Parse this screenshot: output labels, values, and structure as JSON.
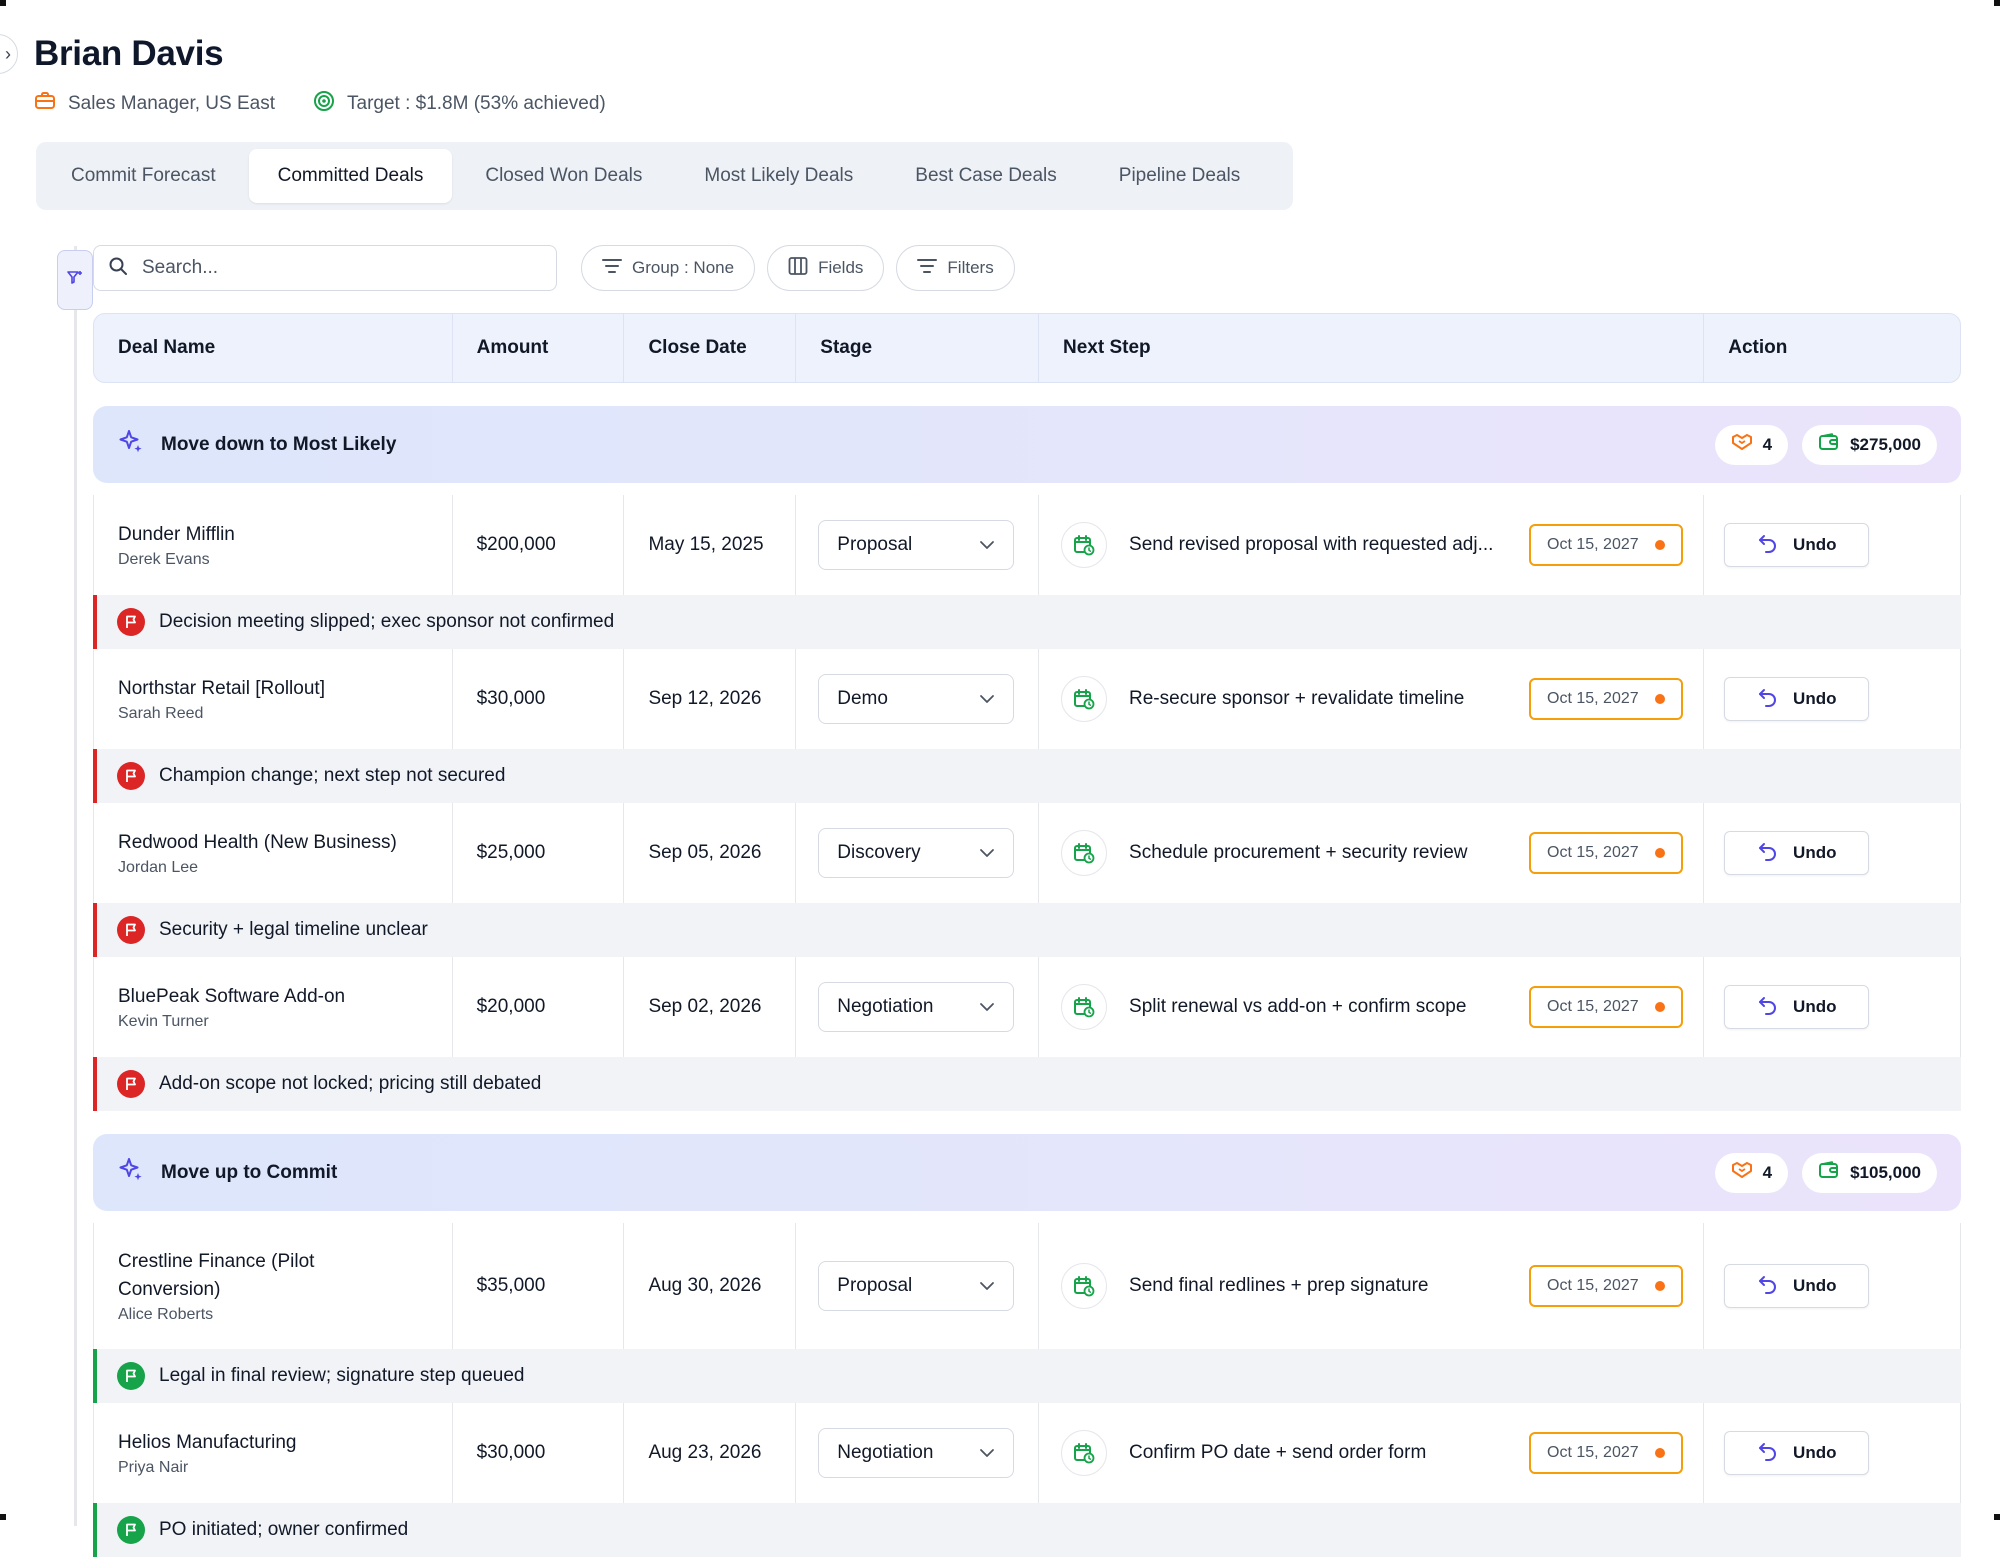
{
  "header": {
    "title": "Brian Davis",
    "role": "Sales Manager, US East",
    "target": "Target : $1.8M (53% achieved)"
  },
  "tabs": [
    {
      "label": "Commit Forecast",
      "active": false
    },
    {
      "label": "Committed Deals",
      "active": true
    },
    {
      "label": "Closed Won Deals",
      "active": false
    },
    {
      "label": "Most Likely Deals",
      "active": false
    },
    {
      "label": "Best Case Deals",
      "active": false
    },
    {
      "label": "Pipeline Deals",
      "active": false
    }
  ],
  "toolbar": {
    "search_placeholder": "Search...",
    "group_label": "Group : None",
    "fields_label": "Fields",
    "filters_label": "Filters"
  },
  "columns": [
    "Deal Name",
    "Amount",
    "Close Date",
    "Stage",
    "Next Step",
    "Action"
  ],
  "groups": [
    {
      "title": "Move down to Most Likely",
      "count": "4",
      "total": "$275,000",
      "deals": [
        {
          "name": "Dunder Mifflin",
          "owner": "Derek Evans",
          "amount": "$200,000",
          "close_date": "May 15, 2025",
          "stage": "Proposal",
          "next_step": "Send revised proposal with requested adj...",
          "step_date": "Oct 15, 2027",
          "action": "Undo",
          "note": "Decision meeting slipped; exec sponsor not confirmed",
          "note_status": "red"
        },
        {
          "name": "Northstar Retail [Rollout]",
          "owner": "Sarah Reed",
          "amount": "$30,000",
          "close_date": "Sep 12, 2026",
          "stage": "Demo",
          "next_step": "Re-secure sponsor + revalidate timeline",
          "step_date": "Oct 15, 2027",
          "action": "Undo",
          "note": "Champion change; next step not secured",
          "note_status": "red"
        },
        {
          "name": "Redwood Health (New Business)",
          "owner": "Jordan Lee",
          "amount": "$25,000",
          "close_date": "Sep 05, 2026",
          "stage": "Discovery",
          "next_step": "Schedule procurement + security review",
          "step_date": "Oct 15, 2027",
          "action": "Undo",
          "note": "Security + legal timeline unclear",
          "note_status": "red"
        },
        {
          "name": "BluePeak Software Add-on",
          "owner": "Kevin Turner",
          "amount": "$20,000",
          "close_date": "Sep 02, 2026",
          "stage": "Negotiation",
          "next_step": "Split renewal vs add-on + confirm scope",
          "step_date": "Oct 15, 2027",
          "action": "Undo",
          "note": "Add-on scope not locked; pricing still debated",
          "note_status": "red"
        }
      ]
    },
    {
      "title": "Move up to Commit",
      "count": "4",
      "total": "$105,000",
      "deals": [
        {
          "name": "Crestline Finance (Pilot Conversion)",
          "owner": "Alice Roberts",
          "amount": "$35,000",
          "close_date": "Aug 30, 2026",
          "stage": "Proposal",
          "next_step": "Send final redlines + prep signature",
          "step_date": "Oct 15, 2027",
          "action": "Undo",
          "note": "Legal in final review; signature step queued",
          "note_status": "green"
        },
        {
          "name": "Helios Manufacturing",
          "owner": "Priya Nair",
          "amount": "$30,000",
          "close_date": "Aug 23, 2026",
          "stage": "Negotiation",
          "next_step": "Confirm PO date + send order form",
          "step_date": "Oct 15, 2027",
          "action": "Undo",
          "note": "PO initiated; owner confirmed",
          "note_status": "green"
        }
      ]
    }
  ],
  "colors": {
    "accent": "#4f46e5",
    "risk_red": "#dc2626",
    "risk_green": "#16a34a",
    "date_badge_border": "#f59e0b",
    "group_gradient_start": "#dde6fb",
    "group_gradient_end": "#ebe3fb"
  },
  "icons": {
    "role": "briefcase-icon",
    "target": "target-icon",
    "search": "search-icon",
    "group": "group-lines-icon",
    "fields": "columns-icon",
    "filters": "filter-icon",
    "group_header": "sparkles-icon",
    "deal_count": "handshake-icon",
    "total": "wallet-icon",
    "next_step": "calendar-clock-icon",
    "undo": "undo-icon",
    "note": "flag-icon"
  }
}
